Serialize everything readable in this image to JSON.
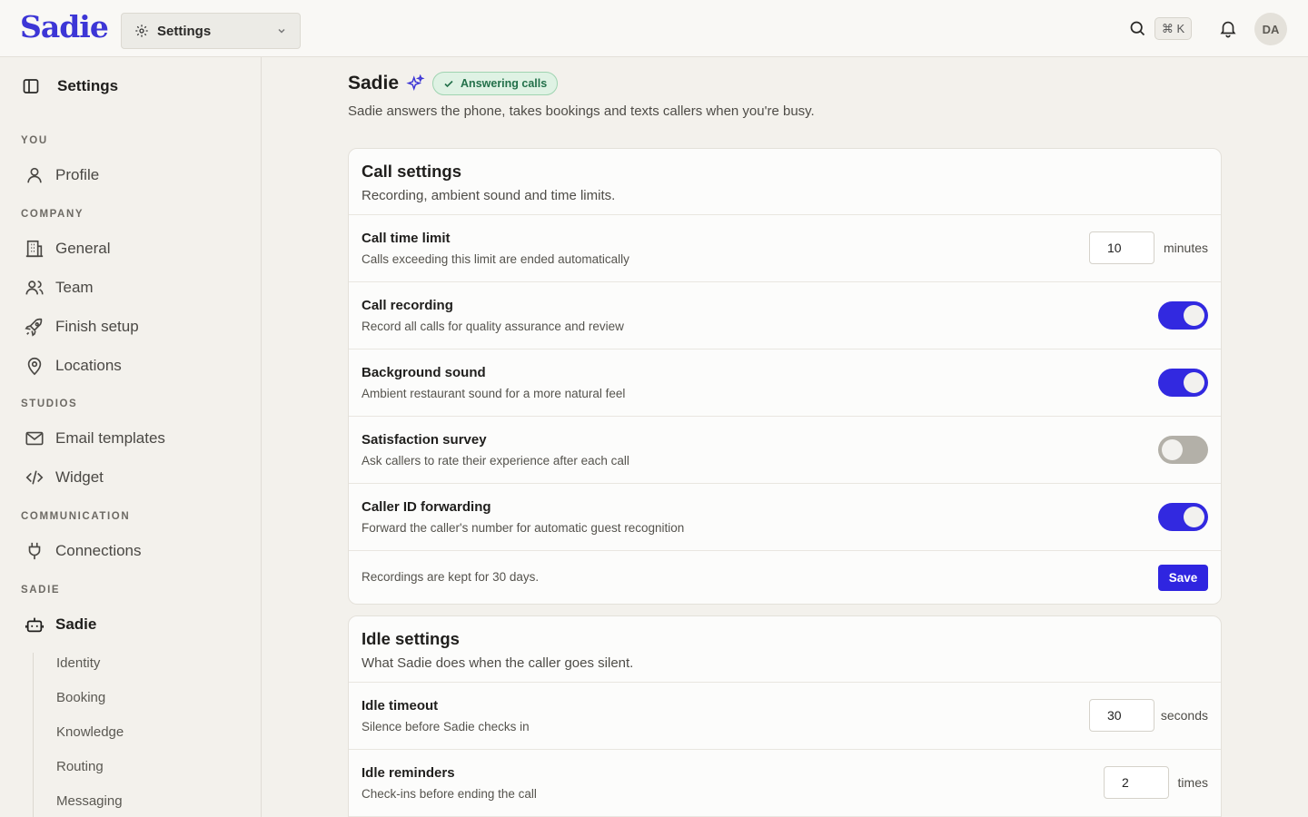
{
  "app": {
    "logo": "Sadie",
    "workspace": "Settings",
    "kbd": "⌘ K",
    "user_initials": "DA"
  },
  "sidebar": {
    "title": "Settings",
    "sections": {
      "you": "YOU",
      "company": "COMPANY",
      "studios": "STUDIOS",
      "communication": "COMMUNICATION",
      "sadie": "SADIE"
    },
    "items": {
      "profile": "Profile",
      "general": "General",
      "team": "Team",
      "finish_setup": "Finish setup",
      "locations": "Locations",
      "email_templates": "Email templates",
      "widget": "Widget",
      "connections": "Connections",
      "sadie": "Sadie"
    },
    "sub_items": [
      "Identity",
      "Booking",
      "Knowledge",
      "Routing",
      "Messaging"
    ]
  },
  "page": {
    "title": "Sadie",
    "status": "Answering calls",
    "subtitle": "Sadie answers the phone, takes bookings and texts callers when you're busy."
  },
  "call_settings": {
    "title": "Call settings",
    "description": "Recording, ambient sound and time limits.",
    "time_limit": {
      "title": "Call time limit",
      "desc": "Calls exceeding this limit are ended automatically",
      "value": "10",
      "unit": "minutes"
    },
    "recording": {
      "title": "Call recording",
      "desc": "Record all calls for quality assurance and review",
      "enabled": true
    },
    "background": {
      "title": "Background sound",
      "desc": "Ambient restaurant sound for a more natural feel",
      "enabled": true
    },
    "survey": {
      "title": "Satisfaction survey",
      "desc": "Ask callers to rate their experience after each call",
      "enabled": false
    },
    "caller_id": {
      "title": "Caller ID forwarding",
      "desc": "Forward the caller's number for automatic guest recognition",
      "enabled": true
    },
    "footer_note": "Recordings are kept for 30 days.",
    "save_label": "Save"
  },
  "idle_settings": {
    "title": "Idle settings",
    "description": "What Sadie does when the caller goes silent.",
    "timeout": {
      "title": "Idle timeout",
      "desc": "Silence before Sadie checks in",
      "value": "30",
      "unit": "seconds"
    },
    "reminders": {
      "title": "Idle reminders",
      "desc": "Check-ins before ending the call",
      "value": "2",
      "unit": "times"
    }
  },
  "colors": {
    "accent": "#3229e0",
    "brand": "#3d36d6",
    "success": "#23704a"
  }
}
